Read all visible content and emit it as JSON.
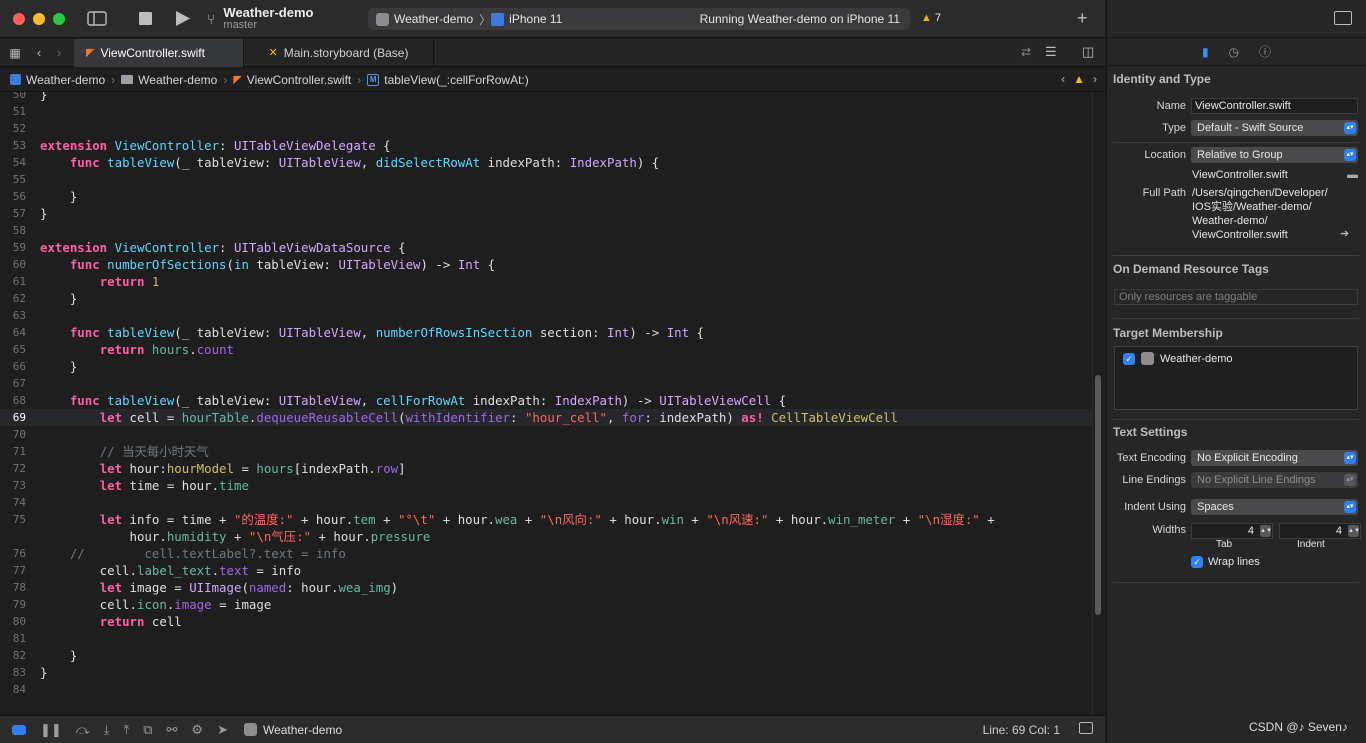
{
  "toolbar": {
    "project_name": "Weather-demo",
    "branch": "master",
    "scheme": "Weather-demo",
    "device": "iPhone 11",
    "status": "Running Weather-demo on iPhone 11",
    "warnings": "7"
  },
  "tabs": [
    {
      "label": "ViewController.swift"
    },
    {
      "label": "Main.storyboard (Base)"
    }
  ],
  "jumpbar": {
    "project": "Weather-demo",
    "group": "Weather-demo",
    "file": "ViewController.swift",
    "symbol_icon": "M",
    "symbol": "tableView(_:cellForRowAt:)"
  },
  "editor": {
    "current_line": "69",
    "lines": [
      {
        "n": "50",
        "segs": [
          [
            "pl",
            "}"
          ]
        ]
      },
      {
        "n": "51",
        "segs": []
      },
      {
        "n": "52",
        "segs": []
      },
      {
        "n": "53",
        "segs": [
          [
            "kw",
            "extension "
          ],
          [
            "ty",
            "ViewController"
          ],
          [
            "pl",
            ": "
          ],
          [
            "tx",
            "UITableViewDelegate"
          ],
          [
            "pl",
            " {"
          ]
        ]
      },
      {
        "n": "54",
        "segs": [
          [
            "pl",
            "    "
          ],
          [
            "kw",
            "func "
          ],
          [
            "ty",
            "tableView"
          ],
          [
            "pl",
            "(_ tableView: "
          ],
          [
            "tx",
            "UITableView"
          ],
          [
            "pl",
            ", "
          ],
          [
            "ty",
            "didSelectRowAt"
          ],
          [
            "pl",
            " indexPath: "
          ],
          [
            "tx",
            "IndexPath"
          ],
          [
            "pl",
            ") {"
          ]
        ]
      },
      {
        "n": "55",
        "segs": []
      },
      {
        "n": "56",
        "segs": [
          [
            "pl",
            "    }"
          ]
        ]
      },
      {
        "n": "57",
        "segs": [
          [
            "pl",
            "}"
          ]
        ]
      },
      {
        "n": "58",
        "segs": []
      },
      {
        "n": "59",
        "segs": [
          [
            "kw",
            "extension "
          ],
          [
            "ty",
            "ViewController"
          ],
          [
            "pl",
            ": "
          ],
          [
            "tx",
            "UITableViewDataSource"
          ],
          [
            "pl",
            " {"
          ]
        ]
      },
      {
        "n": "60",
        "segs": [
          [
            "pl",
            "    "
          ],
          [
            "kw",
            "func "
          ],
          [
            "ty",
            "numberOfSections"
          ],
          [
            "pl",
            "("
          ],
          [
            "ty",
            "in"
          ],
          [
            "pl",
            " tableView: "
          ],
          [
            "tx",
            "UITableView"
          ],
          [
            "pl",
            ") -> "
          ],
          [
            "tx",
            "Int"
          ],
          [
            "pl",
            " {"
          ]
        ]
      },
      {
        "n": "61",
        "segs": [
          [
            "pl",
            "        "
          ],
          [
            "kw",
            "return "
          ],
          [
            "nm",
            "1"
          ]
        ]
      },
      {
        "n": "62",
        "segs": [
          [
            "pl",
            "    }"
          ]
        ]
      },
      {
        "n": "63",
        "segs": []
      },
      {
        "n": "64",
        "segs": [
          [
            "pl",
            "    "
          ],
          [
            "kw",
            "func "
          ],
          [
            "ty",
            "tableView"
          ],
          [
            "pl",
            "(_ tableView: "
          ],
          [
            "tx",
            "UITableView"
          ],
          [
            "pl",
            ", "
          ],
          [
            "ty",
            "numberOfRowsInSection"
          ],
          [
            "pl",
            " section: "
          ],
          [
            "tx",
            "Int"
          ],
          [
            "pl",
            ") -> "
          ],
          [
            "tx",
            "Int"
          ],
          [
            "pl",
            " {"
          ]
        ]
      },
      {
        "n": "65",
        "segs": [
          [
            "pl",
            "        "
          ],
          [
            "kw",
            "return "
          ],
          [
            "fn",
            "hours"
          ],
          [
            "pl",
            "."
          ],
          [
            "mt",
            "count"
          ]
        ]
      },
      {
        "n": "66",
        "segs": [
          [
            "pl",
            "    }"
          ]
        ]
      },
      {
        "n": "67",
        "segs": []
      },
      {
        "n": "68",
        "segs": [
          [
            "pl",
            "    "
          ],
          [
            "kw",
            "func "
          ],
          [
            "ty",
            "tableView"
          ],
          [
            "pl",
            "(_ tableView: "
          ],
          [
            "tx",
            "UITableView"
          ],
          [
            "pl",
            ", "
          ],
          [
            "ty",
            "cellForRowAt"
          ],
          [
            "pl",
            " indexPath: "
          ],
          [
            "tx",
            "IndexPath"
          ],
          [
            "pl",
            ") -> "
          ],
          [
            "tx",
            "UITableViewCell"
          ],
          [
            "pl",
            " {"
          ]
        ]
      },
      {
        "n": "69",
        "segs": [
          [
            "pl",
            "        "
          ],
          [
            "kw",
            "let "
          ],
          [
            "pl",
            "cell = "
          ],
          [
            "fn",
            "hourTable"
          ],
          [
            "pl",
            "."
          ],
          [
            "mt",
            "dequeueReusableCell"
          ],
          [
            "pl",
            "("
          ],
          [
            "mt",
            "withIdentifier"
          ],
          [
            "pl",
            ": "
          ],
          [
            "st",
            "\"hour_cell\""
          ],
          [
            "pl",
            ", "
          ],
          [
            "mt",
            "for"
          ],
          [
            "pl",
            ": indexPath) "
          ],
          [
            "kw",
            "as! "
          ],
          [
            "nm",
            "CellTableViewCell"
          ]
        ]
      },
      {
        "n": "70",
        "segs": []
      },
      {
        "n": "71",
        "segs": [
          [
            "pl",
            "        "
          ],
          [
            "cm",
            "// 当天每小时天气"
          ]
        ]
      },
      {
        "n": "72",
        "segs": [
          [
            "pl",
            "        "
          ],
          [
            "kw",
            "let "
          ],
          [
            "pl",
            "hour:"
          ],
          [
            "nm",
            "hourModel"
          ],
          [
            "pl",
            " = "
          ],
          [
            "fn",
            "hours"
          ],
          [
            "pl",
            "[indexPath."
          ],
          [
            "mt",
            "row"
          ],
          [
            "pl",
            "]"
          ]
        ]
      },
      {
        "n": "73",
        "segs": [
          [
            "pl",
            "        "
          ],
          [
            "kw",
            "let "
          ],
          [
            "pl",
            "time = hour."
          ],
          [
            "fn",
            "time"
          ]
        ]
      },
      {
        "n": "74",
        "segs": []
      },
      {
        "n": "75",
        "segs": [
          [
            "pl",
            "        "
          ],
          [
            "kw",
            "let "
          ],
          [
            "pl",
            "info = time + "
          ],
          [
            "st",
            "\"的温度:\""
          ],
          [
            "pl",
            " + hour."
          ],
          [
            "fn",
            "tem"
          ],
          [
            "pl",
            " + "
          ],
          [
            "st",
            "\"°\\t\""
          ],
          [
            "pl",
            " + hour."
          ],
          [
            "fn",
            "wea"
          ],
          [
            "pl",
            " + "
          ],
          [
            "st",
            "\"\\n风向:\""
          ],
          [
            "pl",
            " + hour."
          ],
          [
            "fn",
            "win"
          ],
          [
            "pl",
            " + "
          ],
          [
            "st",
            "\"\\n风速:\""
          ],
          [
            "pl",
            " + hour."
          ],
          [
            "fn",
            "win_meter"
          ],
          [
            "pl",
            " + "
          ],
          [
            "st",
            "\"\\n湿度:\""
          ],
          [
            "pl",
            " +"
          ]
        ]
      },
      {
        "n": "",
        "segs": [
          [
            "pl",
            "            hour."
          ],
          [
            "fn",
            "humidity"
          ],
          [
            "pl",
            " + "
          ],
          [
            "st",
            "\"\\n气压:\""
          ],
          [
            "pl",
            " + hour."
          ],
          [
            "fn",
            "pressure"
          ]
        ]
      },
      {
        "n": "76",
        "segs": [
          [
            "cm",
            "    //        cell.textLabel?.text = info"
          ]
        ]
      },
      {
        "n": "77",
        "segs": [
          [
            "pl",
            "        cell."
          ],
          [
            "fn",
            "label_text"
          ],
          [
            "pl",
            "."
          ],
          [
            "mt",
            "text"
          ],
          [
            "pl",
            " = info"
          ]
        ]
      },
      {
        "n": "78",
        "segs": [
          [
            "pl",
            "        "
          ],
          [
            "kw",
            "let "
          ],
          [
            "pl",
            "image = "
          ],
          [
            "tx",
            "UIImage"
          ],
          [
            "pl",
            "("
          ],
          [
            "mt",
            "named"
          ],
          [
            "pl",
            ": hour."
          ],
          [
            "fn",
            "wea_img"
          ],
          [
            "pl",
            ")"
          ]
        ]
      },
      {
        "n": "79",
        "segs": [
          [
            "pl",
            "        cell."
          ],
          [
            "fn",
            "icon"
          ],
          [
            "pl",
            "."
          ],
          [
            "mt",
            "image"
          ],
          [
            "pl",
            " = image"
          ]
        ]
      },
      {
        "n": "80",
        "segs": [
          [
            "pl",
            "        "
          ],
          [
            "kw",
            "return "
          ],
          [
            "pl",
            "cell"
          ]
        ]
      },
      {
        "n": "81",
        "segs": []
      },
      {
        "n": "82",
        "segs": [
          [
            "pl",
            "    }"
          ]
        ]
      },
      {
        "n": "83",
        "segs": [
          [
            "pl",
            "}"
          ]
        ]
      },
      {
        "n": "84",
        "segs": []
      }
    ]
  },
  "bottombar": {
    "target": "Weather-demo",
    "position": "Line: 69  Col: 1"
  },
  "inspector": {
    "identity_title": "Identity and Type",
    "name_label": "Name",
    "name_value": "ViewController.swift",
    "type_label": "Type",
    "type_value": "Default - Swift Source",
    "location_label": "Location",
    "location_value": "Relative to Group",
    "location_file": "ViewController.swift",
    "fullpath_label": "Full Path",
    "fullpath_1": "/Users/qingchen/Developer/",
    "fullpath_2": "IOS实验/Weather-demo/",
    "fullpath_3": "Weather-demo/",
    "fullpath_4": "ViewController.swift",
    "odr_title": "On Demand Resource Tags",
    "odr_placeholder": "Only resources are taggable",
    "target_title": "Target Membership",
    "target_item": "Weather-demo",
    "text_title": "Text Settings",
    "encoding_label": "Text Encoding",
    "encoding_value": "No Explicit Encoding",
    "endings_label": "Line Endings",
    "endings_value": "No Explicit Line Endings",
    "indent_label": "Indent Using",
    "indent_value": "Spaces",
    "widths_label": "Widths",
    "tab_value": "4",
    "indent_width_value": "4",
    "tab_caption": "Tab",
    "indent_caption": "Indent",
    "wrap_label": "Wrap lines"
  },
  "watermark": "CSDN @♪ Seven♪",
  "colors": {
    "keyword": "#fc5fa3",
    "type_decl": "#5dd8ff",
    "string": "#fc6a5d",
    "accent": "#2f7ff5"
  }
}
